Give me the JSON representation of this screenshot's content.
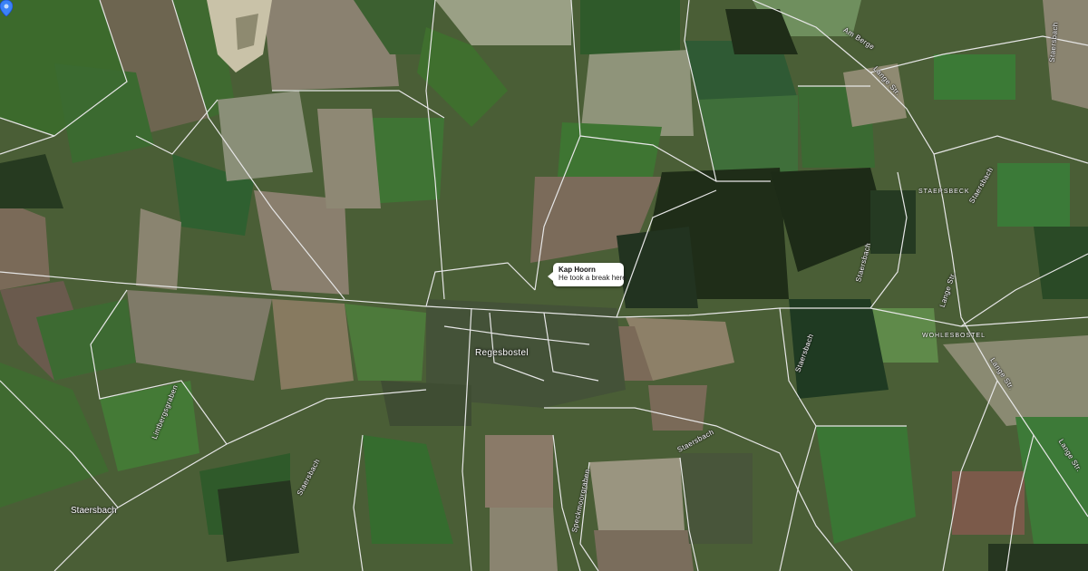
{
  "map": {
    "marker": {
      "title": "Kap Hoorn",
      "description": "He took a break here",
      "color": "#3b82f6"
    },
    "places": {
      "village": "Regesbostel",
      "hamlet_1": "STAERSBECK",
      "hamlet_2": "WOHLESBOSTEL",
      "area_sw": "Staersbach"
    },
    "roads": {
      "am_berge": "Am Berge",
      "lange_str_1": "Lange Str.",
      "lange_str_2": "Lange Str.",
      "lange_str_3": "Lange Str.",
      "lange_str_4": "Lange Str.",
      "lange_str_5": "Lange Str. - W",
      "staersbach_1": "Staersbach",
      "staersbach_2": "Staersbach",
      "staersbach_3": "Staersbach",
      "staersbach_4": "Staersbach",
      "staersbach_5": "Staersbach",
      "staersbach_6": "Staersbach",
      "lintbergsgraben": "Lintbergsgraben",
      "speckmoorgraben": "Speckmoorgraben",
      "landstr": "Landstr"
    },
    "colors": {
      "field_dark": "#2f4a24",
      "field_mid": "#4d6b3a",
      "field_light": "#7f8e63",
      "soil": "#7a6a58",
      "forest": "#1f2d18",
      "road": "#e8e8e8"
    }
  }
}
